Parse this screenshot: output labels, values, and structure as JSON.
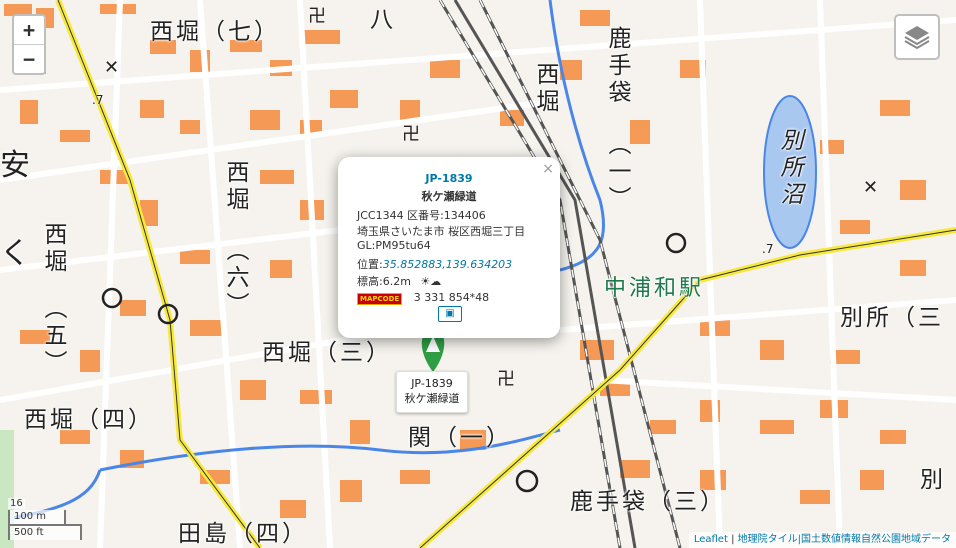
{
  "map": {
    "labels": {
      "nishibori7": "西堀（七）",
      "nishibori_v_left": "西堀",
      "go": "（五）",
      "roku": "（六）",
      "nishibori_v_mid": "西堀",
      "nishibori_v_top": "西堀",
      "nishibori_san": "西堀（三）",
      "nishibori_yon": "西堀（四）",
      "kanji_ichi": "（一）",
      "seki_ichi": "関（一）",
      "hachi": "八",
      "shikatebukuro_v": "鹿手袋",
      "bessho_numa": "別所沼",
      "nakaurawa_station": "中浦和駅",
      "bessho": "別所（三",
      "shikatebukuro_san": "鹿手袋（三）",
      "tajima_yon": "田島（四）",
      "left_edge_glyph": "安",
      "right_bottom_glyph": "別",
      "route7_a": ".7",
      "route7_b": ".7",
      "left_top_ku": "く"
    },
    "colors": {
      "building": "#f58a3c",
      "road": "#ffffff",
      "highway": "#f7e93b",
      "rail": "#666666",
      "water": "#a9c8f0",
      "river": "#4a86e8"
    }
  },
  "controls": {
    "zoom_in": "+",
    "zoom_out": "−"
  },
  "popup": {
    "close": "×",
    "id": "JP-1839",
    "name": "秋ケ瀬緑道",
    "jcc": "JCC1344 区番号:134406",
    "address": "埼玉県さいたま市 桜区西堀三丁目",
    "gl": "GL:PM95tu64",
    "pos_label": "位置:",
    "pos_value": "35.852883,139.634203",
    "elev": "標高:6.2m",
    "weather_icon": "sun-cloud-icon",
    "mapcode_label": "MAPCODE",
    "mapcode": "3 331 854*48",
    "print_icon": "print-icon"
  },
  "tooltip": {
    "id": "JP-1839",
    "name": "秋ケ瀬緑道"
  },
  "scale": {
    "value": "16",
    "m": "100 m",
    "ft": "500 ft"
  },
  "attribution": {
    "leaflet": "Leaflet",
    "sep": " | ",
    "text": "地理院タイル|国土数値情報自然公園地域データ"
  }
}
